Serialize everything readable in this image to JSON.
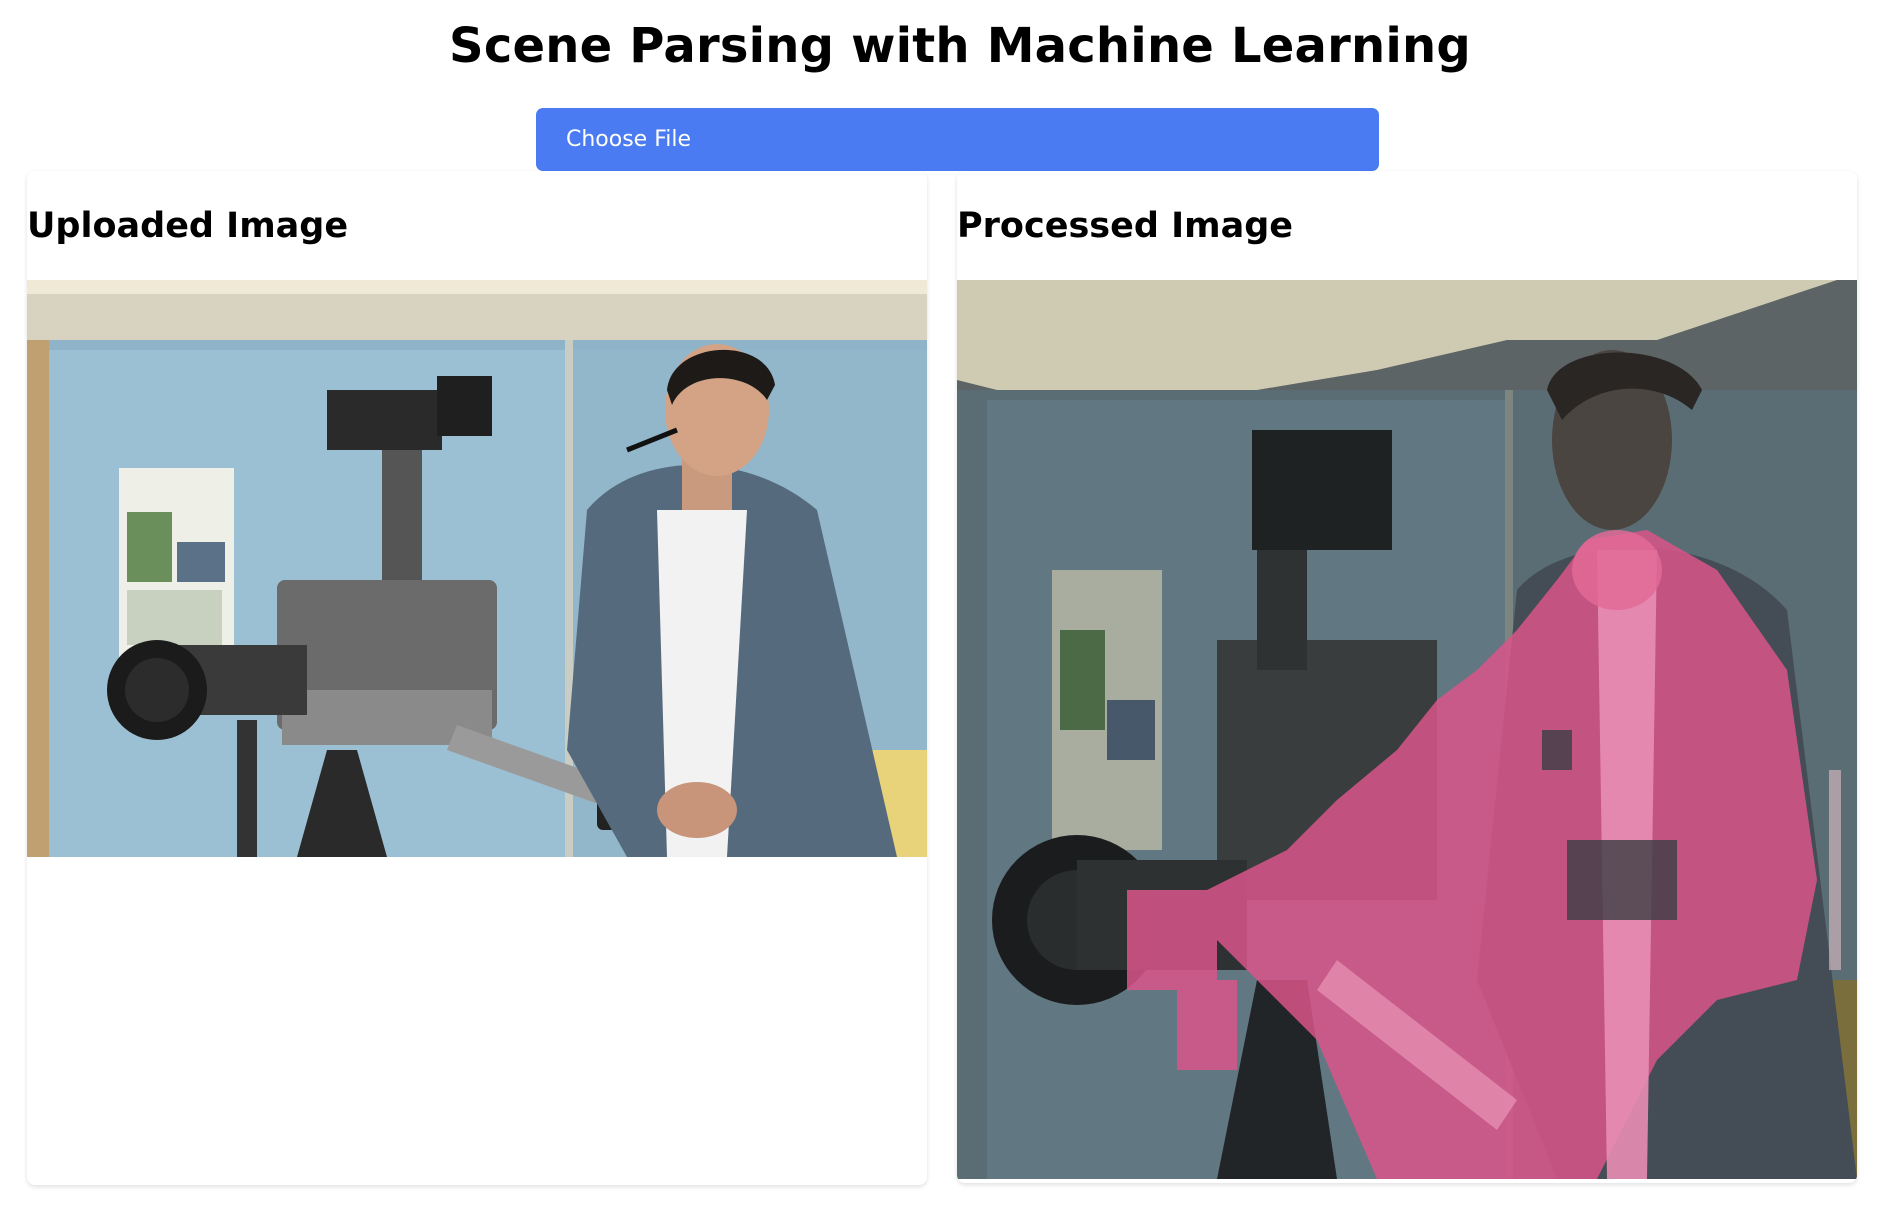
{
  "header": {
    "title": "Scene Parsing with Machine Learning"
  },
  "upload": {
    "button_label": "Choose File"
  },
  "panels": {
    "uploaded": {
      "title": "Uploaded Image",
      "image_desc": "photo-man-with-tv-camera"
    },
    "processed": {
      "title": "Processed Image",
      "image_desc": "segmentation-overlay-man-with-tv-camera"
    }
  },
  "colors": {
    "accent": "#4a7bf3",
    "segment_person": "#e0568a",
    "wall": "#8fb3c8"
  }
}
